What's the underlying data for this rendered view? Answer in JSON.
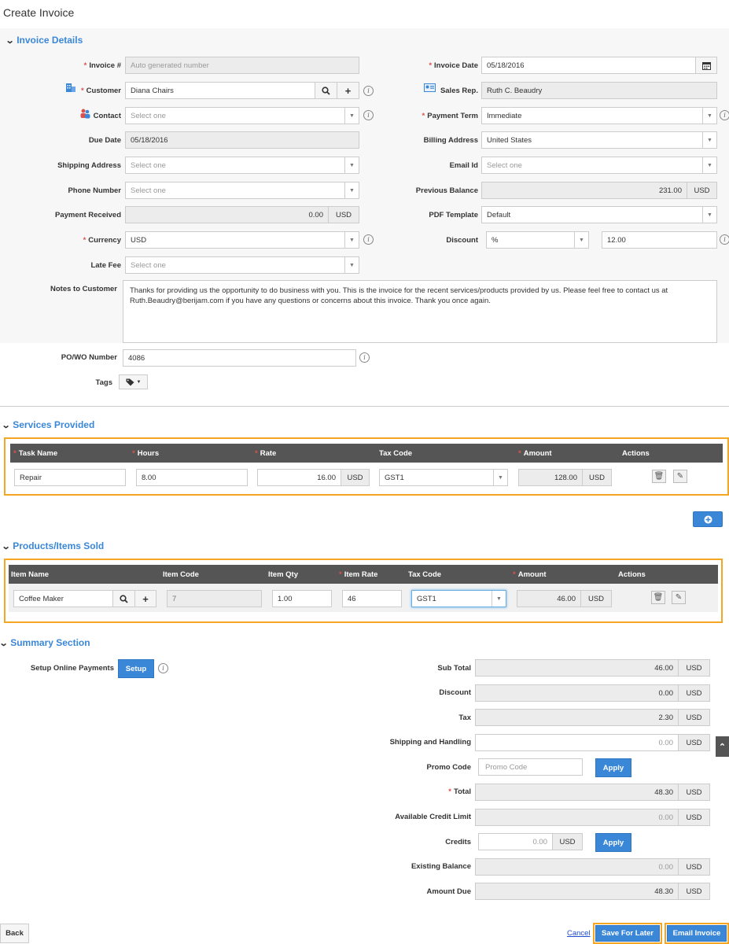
{
  "page": {
    "title": "Create Invoice"
  },
  "invoice_details": {
    "heading": "Invoice Details",
    "invoice_no": {
      "label": "Invoice #",
      "value": "Auto generated number"
    },
    "invoice_date": {
      "label": "Invoice Date",
      "value": "05/18/2016"
    },
    "customer": {
      "label": "Customer",
      "value": "Diana Chairs"
    },
    "sales_rep": {
      "label": "Sales Rep.",
      "value": "Ruth C. Beaudry"
    },
    "contact": {
      "label": "Contact",
      "placeholder": "Select one"
    },
    "payment_term": {
      "label": "Payment Term",
      "value": "Immediate"
    },
    "due_date": {
      "label": "Due Date",
      "value": "05/18/2016"
    },
    "billing_address": {
      "label": "Billing Address",
      "value": "United States"
    },
    "shipping_address": {
      "label": "Shipping Address",
      "placeholder": "Select one"
    },
    "email_id": {
      "label": "Email Id",
      "placeholder": "Select one"
    },
    "phone_number": {
      "label": "Phone Number",
      "placeholder": "Select one"
    },
    "previous_balance": {
      "label": "Previous Balance",
      "value": "231.00",
      "currency": "USD"
    },
    "payment_received": {
      "label": "Payment Received",
      "value": "0.00",
      "currency": "USD"
    },
    "pdf_template": {
      "label": "PDF Template",
      "value": "Default"
    },
    "currency": {
      "label": "Currency",
      "value": "USD"
    },
    "discount": {
      "label": "Discount",
      "type": "%",
      "value": "12.00"
    },
    "late_fee": {
      "label": "Late Fee",
      "placeholder": "Select one"
    },
    "notes": {
      "label": "Notes to Customer",
      "value": "Thanks for providing us the opportunity to do business with you. This is the invoice for the recent services/products provided by us. Please feel free to contact us at Ruth.Beaudry@berijam.com if you have any questions or concerns about this invoice. Thank you once again."
    },
    "po_number": {
      "label": "PO/WO Number",
      "value": "4086"
    },
    "tags": {
      "label": "Tags"
    }
  },
  "services": {
    "heading": "Services Provided",
    "columns": [
      "Task Name",
      "Hours",
      "Rate",
      "Tax Code",
      "Amount",
      "Actions"
    ],
    "row": {
      "task": "Repair",
      "hours": "8.00",
      "rate": "16.00",
      "rate_currency": "USD",
      "tax_code": "GST1",
      "amount": "128.00",
      "amount_currency": "USD"
    }
  },
  "products": {
    "heading": "Products/Items Sold",
    "columns": [
      "Item Name",
      "Item Code",
      "Item Qty",
      "Item Rate",
      "Tax Code",
      "Amount",
      "Actions"
    ],
    "row": {
      "name": "Coffee  Maker",
      "code": "7",
      "qty": "1.00",
      "rate": "46",
      "tax_code": "GST1",
      "amount": "46.00",
      "amount_currency": "USD"
    }
  },
  "summary": {
    "heading": "Summary Section",
    "setup_online_label": "Setup Online Payments",
    "setup_button": "Setup",
    "sub_total": {
      "label": "Sub Total",
      "value": "46.00",
      "currency": "USD"
    },
    "discount": {
      "label": "Discount",
      "value": "0.00",
      "currency": "USD"
    },
    "tax": {
      "label": "Tax",
      "value": "2.30",
      "currency": "USD"
    },
    "shipping": {
      "label": "Shipping and Handling",
      "value": "0.00",
      "currency": "USD"
    },
    "promo": {
      "label": "Promo Code",
      "placeholder": "Promo Code",
      "button": "Apply"
    },
    "total": {
      "label": "Total",
      "value": "48.30",
      "currency": "USD"
    },
    "credit_limit": {
      "label": "Available Credit Limit",
      "value": "0.00",
      "currency": "USD"
    },
    "credits": {
      "label": "Credits",
      "value": "0.00",
      "currency": "USD",
      "button": "Apply"
    },
    "existing_balance": {
      "label": "Existing Balance",
      "value": "0.00",
      "currency": "USD"
    },
    "amount_due": {
      "label": "Amount Due",
      "value": "48.30",
      "currency": "USD"
    }
  },
  "footer": {
    "back": "Back",
    "cancel": "Cancel",
    "save_later": "Save For Later",
    "email_invoice": "Email Invoice"
  },
  "colors": {
    "accent": "#3a87d8",
    "highlight": "#f5a623",
    "table_header": "#555555"
  }
}
